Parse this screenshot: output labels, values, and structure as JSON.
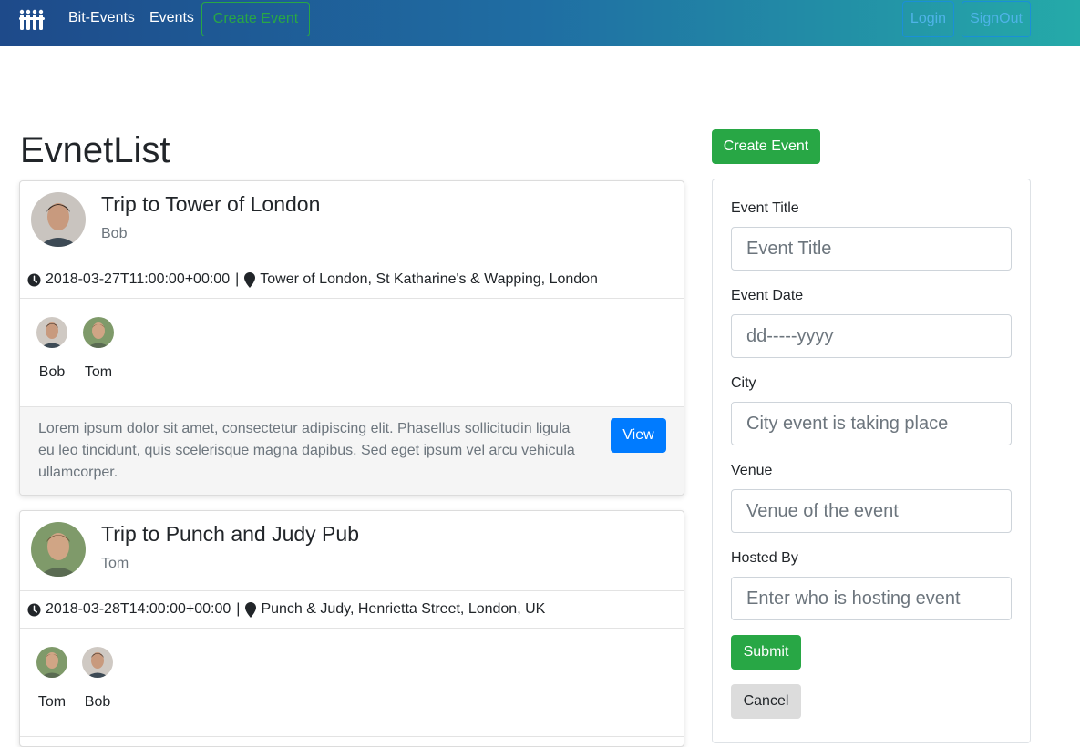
{
  "nav": {
    "brand": "Bit-Events",
    "events": "Events",
    "create_event": "Create Event",
    "login": "Login",
    "signout": "SignOut"
  },
  "page": {
    "title": "EvnetList"
  },
  "events": [
    {
      "title": "Trip to Tower of London",
      "host": "Bob",
      "host_avatar": "person-avatar-bob",
      "date": "2018-03-27T11:00:00+00:00",
      "separator": "|",
      "venue": "Tower of London, St Katharine's & Wapping, London",
      "attendees": [
        {
          "name": "Bob",
          "avatar": "person-avatar-bob"
        },
        {
          "name": "Tom",
          "avatar": "person-avatar-tom"
        }
      ],
      "description": "Lorem ipsum dolor sit amet, consectetur adipiscing elit. Phasellus sollicitudin ligula eu leo tincidunt, quis scelerisque magna dapibus. Sed eget ipsum vel arcu vehicula ullamcorper.",
      "view_label": "View"
    },
    {
      "title": "Trip to Punch and Judy Pub",
      "host": "Tom",
      "host_avatar": "person-avatar-tom",
      "date": "2018-03-28T14:00:00+00:00",
      "separator": "|",
      "venue": "Punch & Judy, Henrietta Street, London, UK",
      "attendees": [
        {
          "name": "Tom",
          "avatar": "person-avatar-tom"
        },
        {
          "name": "Bob",
          "avatar": "person-avatar-bob"
        }
      ]
    }
  ],
  "form": {
    "create_button": "Create Event",
    "title_label": "Event Title",
    "title_placeholder": "Event Title",
    "date_label": "Event Date",
    "date_placeholder": "dd-----yyyy",
    "city_label": "City",
    "city_placeholder": "City event is taking place",
    "venue_label": "Venue",
    "venue_placeholder": "Venue of the event",
    "hosted_label": "Hosted By",
    "hosted_placeholder": "Enter who is hosting event",
    "submit": "Submit",
    "cancel": "Cancel"
  },
  "colors": {
    "success": "#28a745",
    "primary": "#007bff",
    "nav_gradient_start": "#1e4a8a",
    "nav_gradient_end": "#25aaa9"
  }
}
